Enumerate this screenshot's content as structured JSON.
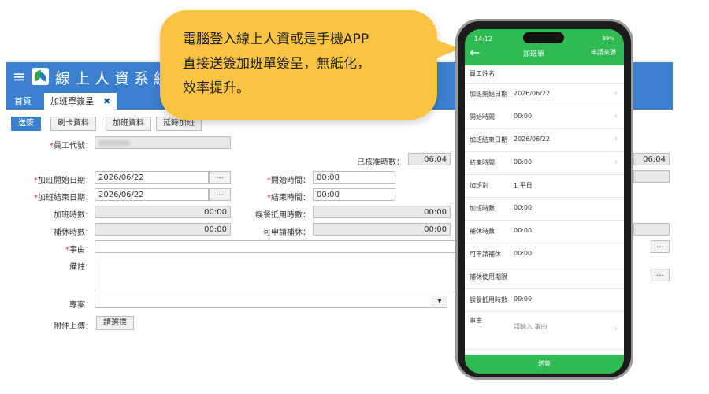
{
  "bubble": {
    "line1": "電腦登入線上人資或是手機APP",
    "line2": "直接送簽加班單簽呈，無紙化，",
    "line3": "效率提升。"
  },
  "app": {
    "system_title": "線上人資系統",
    "tabs": [
      {
        "label": "首頁"
      },
      {
        "label": "加班單簽呈"
      }
    ],
    "close_icon": "✖",
    "buttons": {
      "submit": "送簽",
      "card": "刷卡資料",
      "overtime": "加班資料",
      "other": "延時加班"
    },
    "fields": {
      "employee_id_label": "員工代號：",
      "approved_hours_label": "已核准時數：",
      "approved_hours_value": "06:04",
      "ot_start_date_label": "加班開始日期：",
      "ot_start_date_value": "2026/06/22",
      "start_time_label": "開始時間：",
      "start_time_value": "00:00",
      "ot_end_date_label": "加班結束日期：",
      "ot_end_date_value": "2026/06/22",
      "end_time_label": "結束時間：",
      "end_time_value": "00:00",
      "ot_hours_label": "加班時數：",
      "ot_hours_value": "00:00",
      "meal_deduct_label": "誤餐抵用時數：",
      "meal_deduct_value": "00:00",
      "comp_hours_label": "補休時數：",
      "comp_hours_value": "00:00",
      "applicable_comp_label": "可申請補休：",
      "applicable_comp_value": "00:00",
      "reason_label": "事由：",
      "remark_label": "備註：",
      "project_label": "專案：",
      "attachment_label": "附件上傳：",
      "choose_button": "請選擇",
      "picker": "...",
      "right_time_value": "06:04"
    }
  },
  "phone": {
    "time": "14:12",
    "network": "99%",
    "back": "←",
    "title": "加班單",
    "right": "申請來源",
    "rows": [
      {
        "label": "員工姓名",
        "value": ""
      },
      {
        "label": "加班開始日期",
        "value": "2026/06/22"
      },
      {
        "label": "開始時間",
        "value": "00:00"
      },
      {
        "label": "加班結束日期",
        "value": "2026/06/22"
      },
      {
        "label": "結束時間",
        "value": "00:00"
      },
      {
        "label": "加班別",
        "value": "1 平日"
      },
      {
        "label": "加班時數",
        "value": "00:00"
      },
      {
        "label": "補休時數",
        "value": "00:00"
      },
      {
        "label": "可申請補休",
        "value": "00:00"
      },
      {
        "label": "補休使用期限",
        "value": ""
      },
      {
        "label": "誤餐抵用時數",
        "value": "00:00"
      },
      {
        "label": "事由",
        "value": "請輸入 事由"
      }
    ],
    "submit": "送簽"
  }
}
